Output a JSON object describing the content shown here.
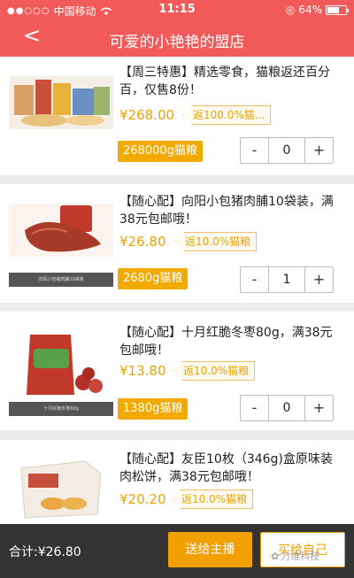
{
  "status": {
    "carrier": "中国移动",
    "time": "11:15",
    "battery": "64%",
    "battery_level": 0.64
  },
  "header": {
    "title": "可爱的小艳艳的盟店"
  },
  "products": [
    {
      "name": "【周三特惠】精选零食，猫粮返还百分百，仅售8份！",
      "price": "¥268.00",
      "rebate": "返100.0%猫...",
      "grain": "268000g猫粮",
      "qty": "0",
      "caption": ""
    },
    {
      "name": "【随心配】向阳小包猪肉脯10袋装，满38元包邮哦！",
      "price": "¥26.80",
      "rebate": "返10.0%猫粮",
      "grain": "2680g猫粮",
      "qty": "1",
      "caption": "向阳小包猪肉脯10袋装"
    },
    {
      "name": "【随心配】十月红脆冬枣80g，满38元包邮哦！",
      "price": "¥13.80",
      "rebate": "返10.0%猫粮",
      "grain": "1380g猫粮",
      "qty": "0",
      "caption": "十月红脆冬枣80g"
    },
    {
      "name": "【随心配】友臣10枚（346g)盒原味装肉松饼，满38元包邮哦！",
      "price": "¥20.20",
      "rebate": "返10.0%猫粮",
      "grain": "",
      "qty": "",
      "caption": ""
    }
  ],
  "stepper": {
    "minus": "-",
    "plus": "+"
  },
  "footer": {
    "total": "合计:¥26.80",
    "send_label": "送给主播",
    "buy_label": "买给自己",
    "watermark": "万维科技"
  },
  "colors": {
    "header": "#f25a5a",
    "accent": "#f2a900",
    "price": "#e8a400",
    "bottom_bar": "#333333"
  }
}
